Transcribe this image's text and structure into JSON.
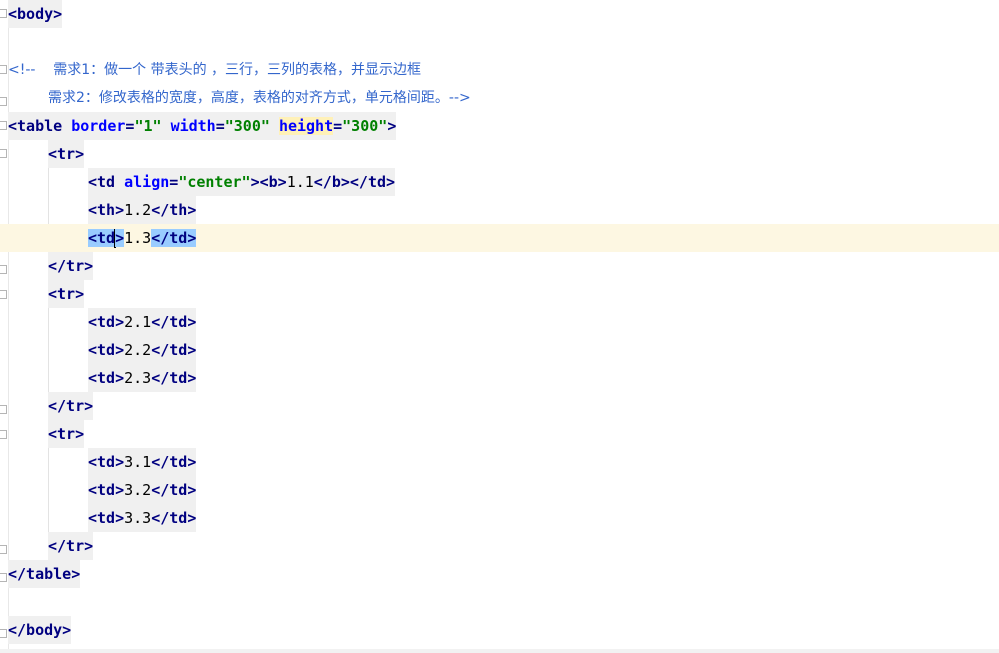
{
  "editor": {
    "lines": [
      {
        "id": "body-open",
        "text": "<body>"
      },
      {
        "id": "blank-1",
        "text": ""
      },
      {
        "id": "comment-1",
        "text": "<!--    需求1：做一个 带表头的 ，三行，三列的表格，并显示边框"
      },
      {
        "id": "comment-2",
        "text": "需求2：修改表格的宽度，高度，表格的对齐方式，单元格间距。-->"
      },
      {
        "id": "table-open",
        "tag": "<table",
        "attrs": [
          {
            "name": "border",
            "value": "\"1\""
          },
          {
            "name": "width",
            "value": "\"300\""
          },
          {
            "name": "height",
            "value": "\"300\""
          }
        ],
        "close": ">"
      },
      {
        "id": "tr1-open",
        "text": "<tr>"
      },
      {
        "id": "cell-1-1",
        "open": "<td",
        "attr_name": "align",
        "attr_value": "\"center\"",
        "open_close": ">",
        "b_open": "<b>",
        "content": "1.1",
        "b_close": "</b>",
        "close": "</td>"
      },
      {
        "id": "cell-1-2",
        "open": "<th>",
        "content": "1.2",
        "close": "</th>"
      },
      {
        "id": "cell-1-3",
        "open_a": "<td",
        "open_b": ">",
        "content": "1.3",
        "close": "</td>"
      },
      {
        "id": "tr1-close",
        "text": "</tr>"
      },
      {
        "id": "tr2-open",
        "text": "<tr>"
      },
      {
        "id": "cell-2-1",
        "open": "<td>",
        "content": "2.1",
        "close": "</td>"
      },
      {
        "id": "cell-2-2",
        "open": "<td>",
        "content": "2.2",
        "close": "</td>"
      },
      {
        "id": "cell-2-3",
        "open": "<td>",
        "content": "2.3",
        "close": "</td>"
      },
      {
        "id": "tr2-close",
        "text": "</tr>"
      },
      {
        "id": "tr3-open",
        "text": "<tr>"
      },
      {
        "id": "cell-3-1",
        "open": "<td>",
        "content": "3.1",
        "close": "</td>"
      },
      {
        "id": "cell-3-2",
        "open": "<td>",
        "content": "3.2",
        "close": "</td>"
      },
      {
        "id": "cell-3-3",
        "open": "<td>",
        "content": "3.3",
        "close": "</td>"
      },
      {
        "id": "tr3-close",
        "text": "</tr>"
      },
      {
        "id": "table-close",
        "text": "</table>"
      },
      {
        "id": "blank-2",
        "text": ""
      },
      {
        "id": "body-close",
        "text": "</body>"
      }
    ]
  },
  "colors": {
    "tag": "#000080",
    "attribute": "#0000ff",
    "value": "#008000",
    "comment": "#3366cc",
    "caret_line": "#fdf7e2",
    "bracket_match": "#99ccff"
  }
}
